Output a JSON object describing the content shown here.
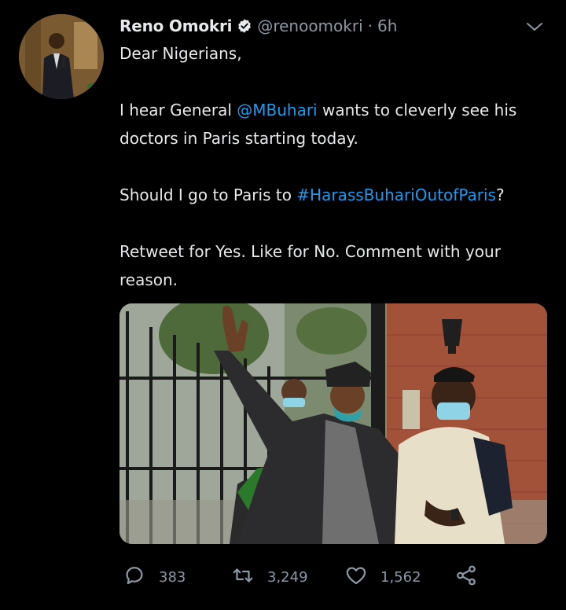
{
  "tweet": {
    "author_name": "Reno Omokri",
    "handle": "@renoomokri",
    "separator": "·",
    "time": "6h",
    "line1": "Dear Nigerians,",
    "p2_pre": "I hear General ",
    "p2_mention": "@MBuhari",
    "p2_post": " wants to cleverly see his doctors in Paris starting today.",
    "p3_pre": "Should I go to Paris to ",
    "p3_hashtag": "#HarassBuhariOutofParis",
    "p3_post": "?",
    "p4": "Retweet for Yes. Like for No. Comment with your reason."
  },
  "actions": {
    "reply_count": "383",
    "retweet_count": "3,249",
    "like_count": "1,562"
  },
  "icons": {
    "verified": "verified-badge-icon",
    "caret": "chevron-down-icon",
    "reply": "reply-icon",
    "retweet": "retweet-icon",
    "like": "heart-icon",
    "share": "share-icon"
  },
  "colors": {
    "background": "#000000",
    "text": "#e7e9ea",
    "secondary": "#8b98a5",
    "link": "#1d9bf0"
  }
}
